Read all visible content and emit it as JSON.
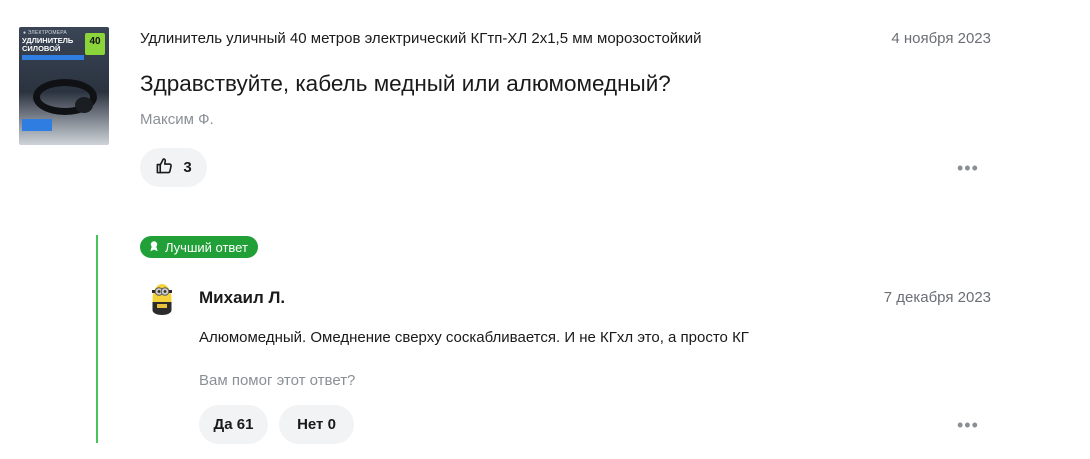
{
  "question": {
    "product_title": "Удлинитель уличный 40 метров электрический КГтп-ХЛ 2х1,5 мм морозостойкий",
    "date": "4 ноября 2023",
    "text": "Здравствуйте, кабель медный или алюмомедный?",
    "author": "Максим Ф.",
    "likes": "3",
    "like_icon": "thumbs-up-icon",
    "more_icon": "•••"
  },
  "product_image": {
    "brand": "● ЭЛЕКТРОМЕРА",
    "title_line1": "УДЛИНИТЕЛЬ",
    "title_line2": "СИЛОВОЙ",
    "badge": "40"
  },
  "answer": {
    "badge_label": "Лучший ответ",
    "badge_icon": "award-icon",
    "author": "Михаил Л.",
    "date": "7 декабря 2023",
    "text": "Алюмомедный. Омеднение сверху соскабливается. И не КГхл это, а просто КГ",
    "helpful_question": "Вам помог этот ответ?",
    "yes_label": "Да 61",
    "no_label": "Нет 0",
    "more_icon": "•••"
  },
  "colors": {
    "accent_green": "#21a038",
    "answer_line": "#47c35b",
    "button_bg": "#f2f3f5",
    "muted_text": "#8a8f96"
  }
}
